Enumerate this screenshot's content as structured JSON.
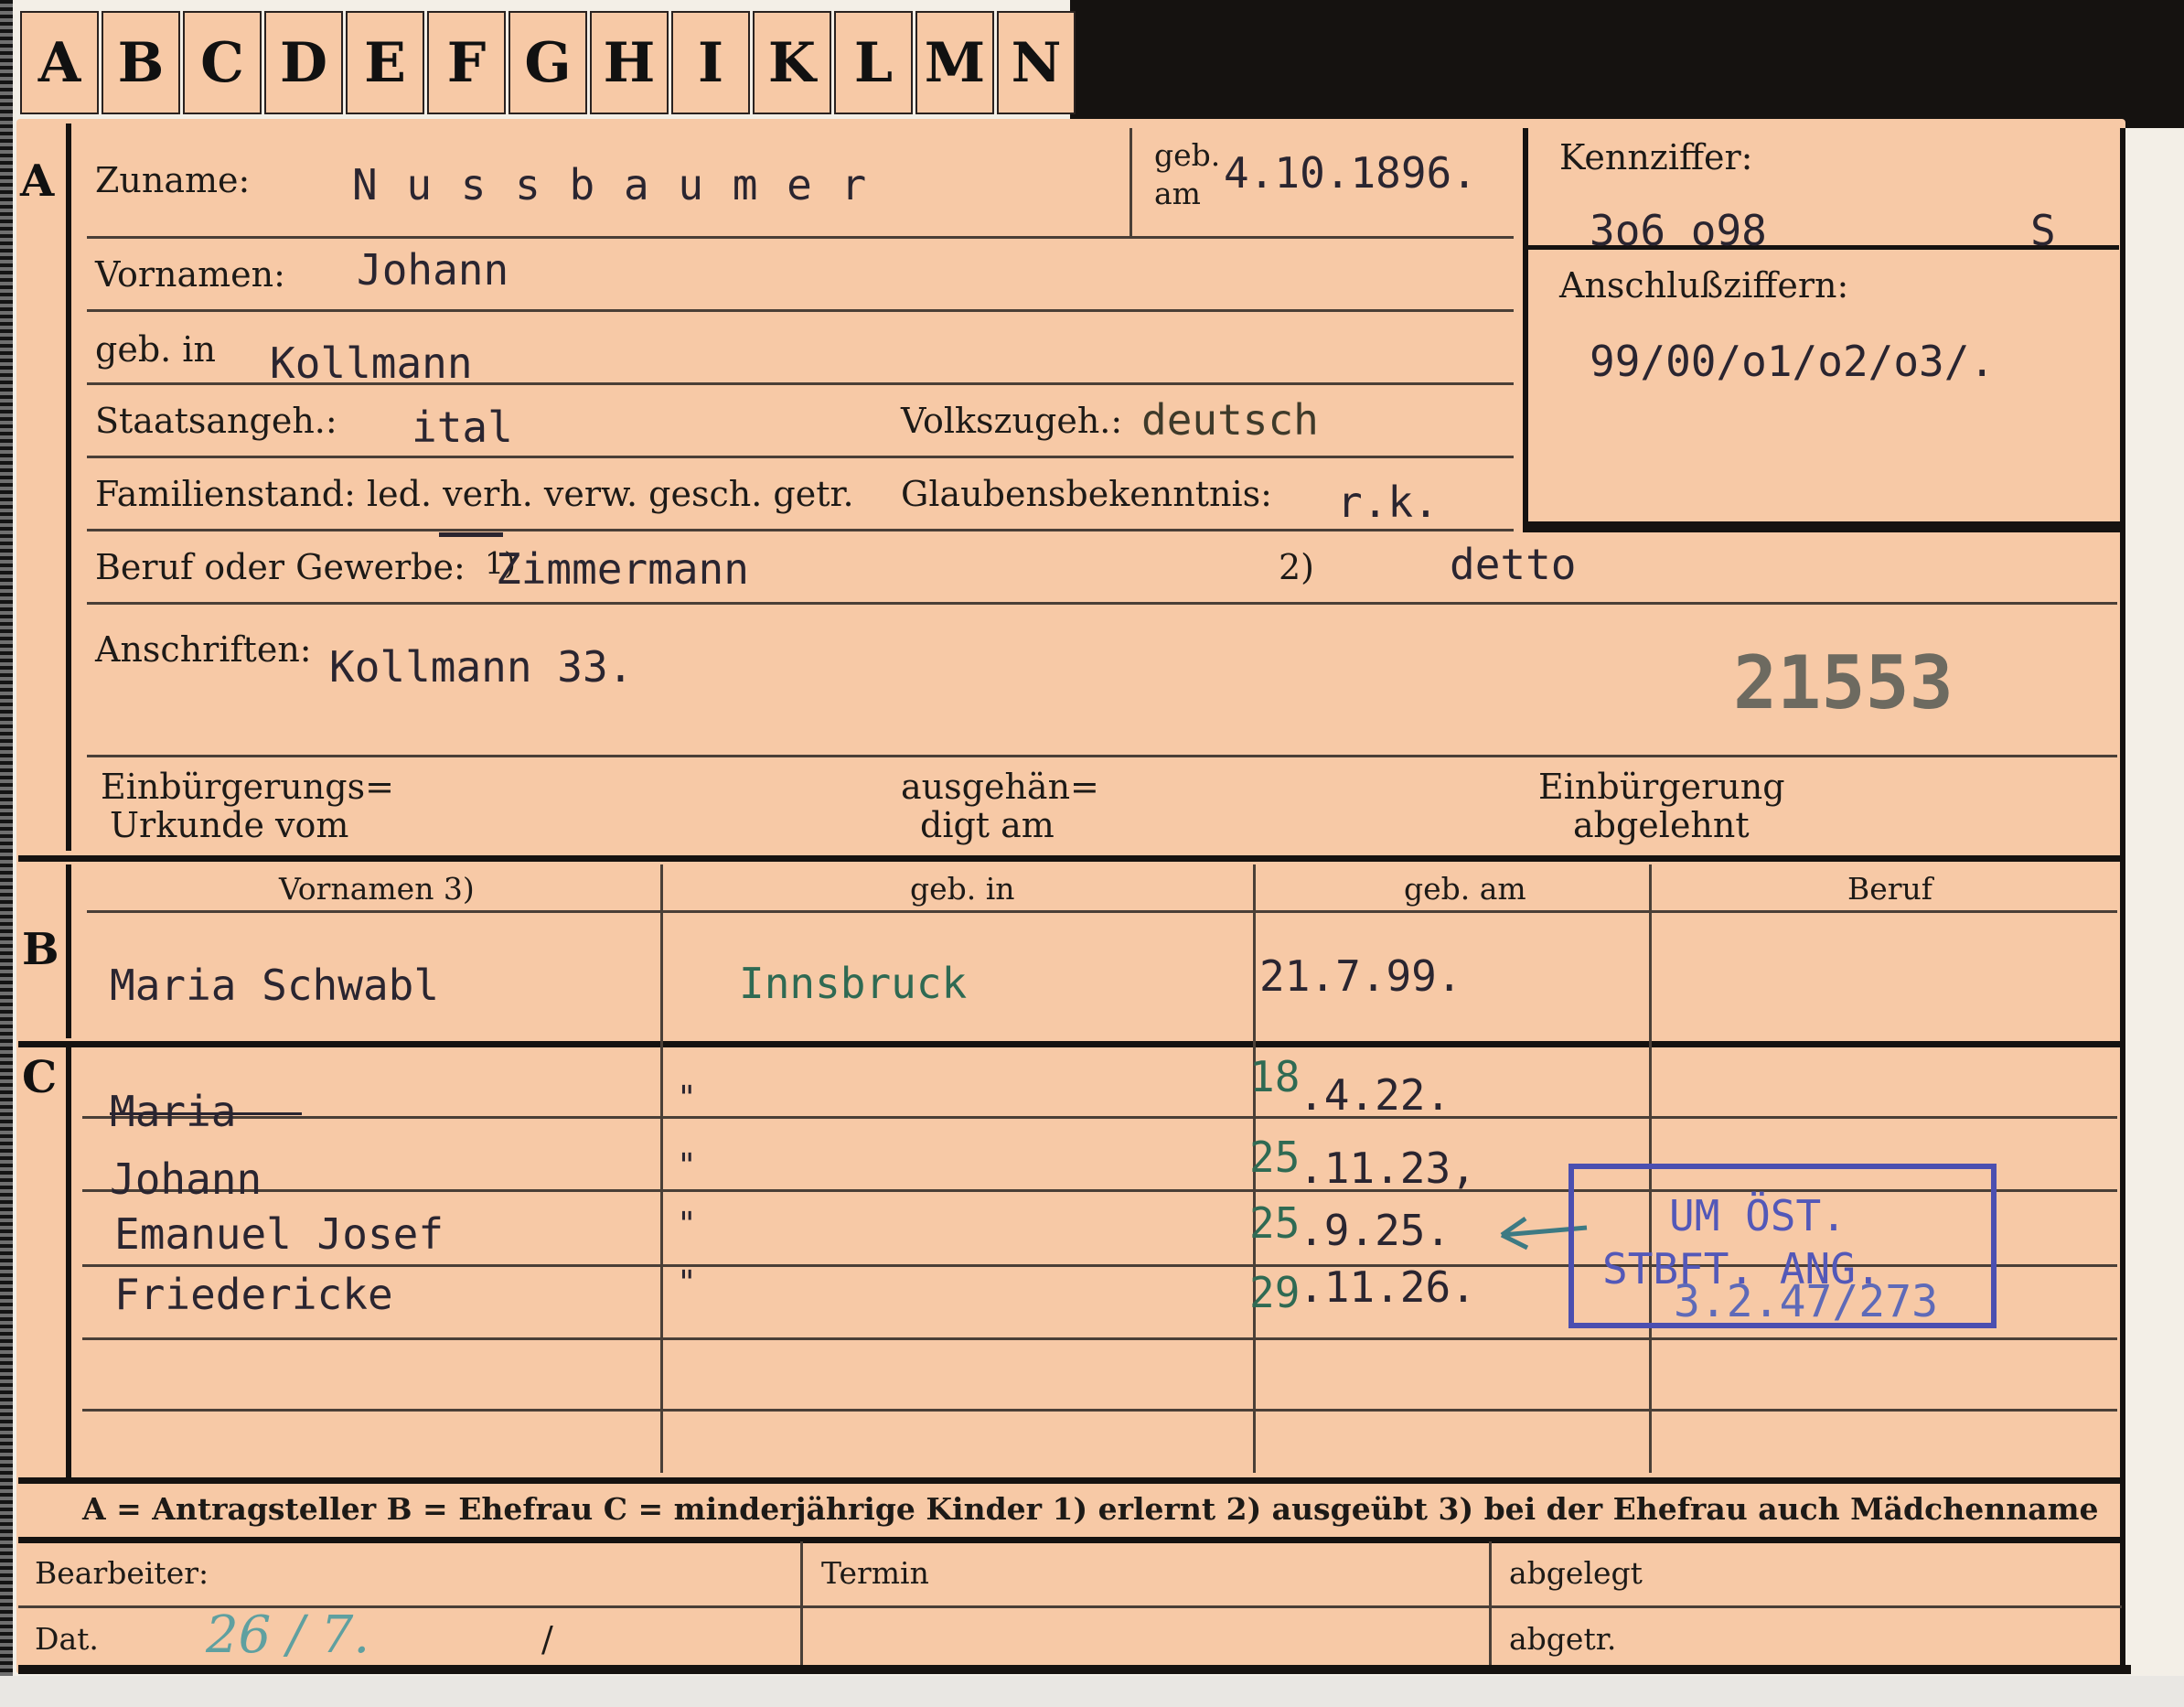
{
  "tabs": [
    "A",
    "B",
    "C",
    "D",
    "E",
    "F",
    "G",
    "H",
    "I",
    "K",
    "L",
    "M",
    "N"
  ],
  "section_letters": {
    "a": "A",
    "b": "B",
    "c": "C"
  },
  "labels": {
    "zuname": "Zuname:",
    "geb": "geb.",
    "am": "am",
    "vornamen": "Vornamen:",
    "geb_in": "geb. in",
    "staatsangeh": "Staatsangeh.:",
    "volkszugeh": "Volkszugeh.:",
    "familienstand": "Familienstand: led. verh. verw. gesch. getr.",
    "glaubensbekenntnis": "Glaubensbekenntnis:",
    "beruf": "Beruf oder Gewerbe:",
    "beruf_fn": "1)",
    "beruf2_fn": "2)",
    "anschriften": "Anschriften:",
    "einburgerungs_1": "Einbürgerungs=",
    "einburgerungs_2": "Urkunde vom",
    "ausgehan_1": "ausgehän=",
    "ausgehan_2": "digt am",
    "abgelehnt_1": "Einbürgerung",
    "abgelehnt_2": "abgelehnt",
    "kennziffer": "Kennziffer:",
    "anschlussziffern": "Anschlußziffern:"
  },
  "person": {
    "surname": "N u s s b a u m e r",
    "birthdate": "4.10.1896.",
    "first_names": "Johann",
    "birthplace": "Kollmann",
    "citizenship": "ital",
    "ethnicity": "deutsch",
    "religion": "r.k.",
    "occupation_learned": "Zimmermann",
    "occupation_practiced": "detto",
    "address": "Kollmann 33.",
    "number_stamp": "21553"
  },
  "kennziffer_value": "3o6 o98",
  "kennziffer_suffix": "S",
  "anschluss_value": "99/00/o1/o2/o3/.",
  "table_headers": {
    "vornamen": "Vornamen 3)",
    "geb_in": "geb. in",
    "geb_am": "geb. am",
    "beruf": "Beruf"
  },
  "spouse": {
    "name": "Maria Schwabl",
    "birthplace": "Innsbruck",
    "birthdate": "21.7.99.",
    "occupation": ""
  },
  "children": [
    {
      "name": "Maria",
      "birthplace": "\"",
      "day": "18",
      "birthdate": ".4.22."
    },
    {
      "name": "Johann",
      "birthplace": "\"",
      "day": "25",
      "birthdate": ".11.23,"
    },
    {
      "name": "Emanuel Josef",
      "birthplace": "\"",
      "day": "25",
      "birthdate": ".9.25."
    },
    {
      "name": "Friedericke",
      "birthplace": "\"",
      "day": "29",
      "birthdate": ".11.26."
    }
  ],
  "stamp": {
    "line1": "UM ÖST.",
    "line2": "STBFT. ANG.",
    "line3": "3.2.47/273"
  },
  "legend": "A = Antragsteller   B = Ehefrau   C = minderjährige Kinder   1) erlernt   2) ausgeübt   3) bei der Ehefrau auch Mädchenname",
  "footer": {
    "bearbeiter": "Bearbeiter:",
    "termin": "Termin",
    "abgelegt": "abgelegt",
    "dat": "Dat.",
    "dat_value": "26 / 7.",
    "slash": "/",
    "abgetr": "abgetr."
  }
}
